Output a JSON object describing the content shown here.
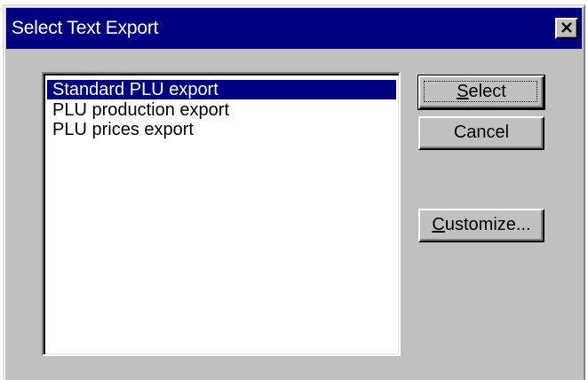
{
  "dialog": {
    "title": "Select Text Export",
    "close_icon": "close-x-icon"
  },
  "list": {
    "items": [
      {
        "label": "Standard PLU export",
        "selected": true
      },
      {
        "label": "PLU production export",
        "selected": false
      },
      {
        "label": "PLU prices export",
        "selected": false
      }
    ]
  },
  "buttons": {
    "select": {
      "mnemonic": "S",
      "rest": "elect"
    },
    "cancel": {
      "label": "Cancel"
    },
    "customize": {
      "mnemonic": "C",
      "rest": "ustomize..."
    }
  },
  "colors": {
    "titlebar": "#000080",
    "face": "#c0c0c0",
    "selection": "#000080"
  }
}
